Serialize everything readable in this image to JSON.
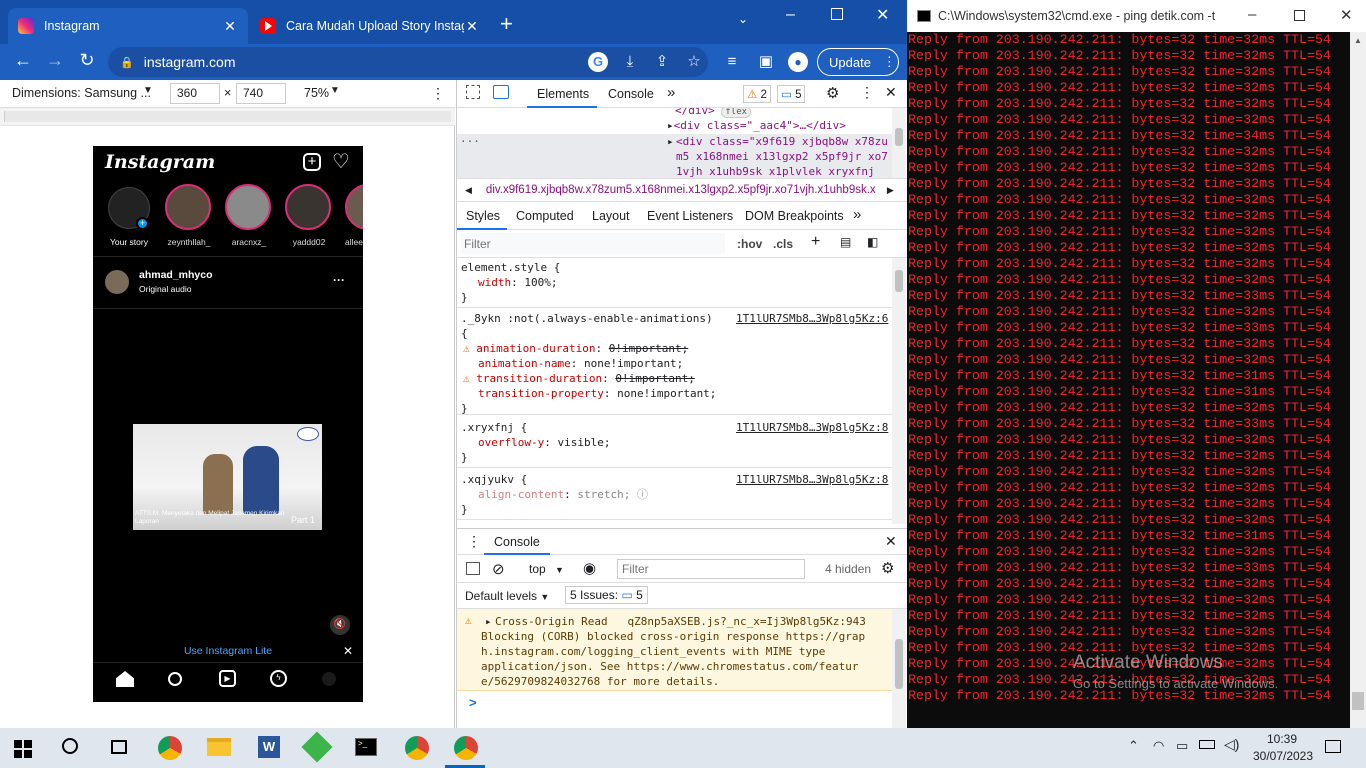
{
  "chrome": {
    "tabs": [
      {
        "title": "Instagram",
        "active": true
      },
      {
        "title": "Cara Mudah Upload Story Instagr",
        "active": false
      }
    ],
    "new_tab": "+",
    "url": "instagram.com",
    "update_label": "Update"
  },
  "device_toolbar": {
    "dimensions_label": "Dimensions: Samsung ...",
    "width": "360",
    "times": "×",
    "height": "740",
    "zoom": "75%"
  },
  "instagram": {
    "logo": "Instagram",
    "stories": [
      {
        "name": "Your story"
      },
      {
        "name": "zeynthllah_"
      },
      {
        "name": "aracnxz_"
      },
      {
        "name": "yaddd02"
      },
      {
        "name": "allee"
      }
    ],
    "post_user": "ahmad_mhyco",
    "post_subtitle": "Original audio",
    "video_caption": "ATTS.M. Menyetaka dan Melipat Jasamen Kirimkan Laporan",
    "video_part": "Part 1",
    "lite_banner": "Use Instagram Lite",
    "more": "···"
  },
  "devtools": {
    "tabs": [
      "Elements",
      "Console"
    ],
    "more_tabs": "»",
    "warn_count": "2",
    "msg_count": "5",
    "dom_lines": [
      {
        "text": "</div>",
        "badge": "flex"
      },
      {
        "text": "<div class=\"_aac4\">…</div>"
      },
      {
        "text": "<div class=\"x9f619 xjbqb8w x78zum5 x168nmei x13lgxp2 x5pf9jr xo71vjh x1uhb9sk x1plvlek xryxfnj"
      }
    ],
    "breadcrumb": "div.x9f619.xjbqb8w.x78zum5.x168nmei.x13lgxp2.x5pf9jr.xo71vjh.x1uhb9sk.x",
    "style_tabs": [
      "Styles",
      "Computed",
      "Layout",
      "Event Listeners",
      "DOM Breakpoints"
    ],
    "filter_placeholder": "Filter",
    "hov": ":hov",
    "cls": ".cls",
    "rules": [
      {
        "selector": "element.style {",
        "source": "",
        "decls": [
          {
            "prop": "width",
            "val": "100%;",
            "struck": false,
            "warn": false
          }
        ]
      },
      {
        "selector": "._8ykn :not(.always-enable-animations)",
        "source": "1T1lUR7SMb8…3Wp8lg5Kz:6",
        "decls": [
          {
            "prop": "animation-duration",
            "val": "0!important;",
            "struck": true,
            "warn": true
          },
          {
            "prop": "animation-name",
            "val": "none!important;",
            "struck": false,
            "warn": false
          },
          {
            "prop": "transition-duration",
            "val": "0!important;",
            "struck": true,
            "warn": true
          },
          {
            "prop": "transition-property",
            "val": "none!important;",
            "struck": false,
            "warn": false
          }
        ]
      },
      {
        "selector": ".xryxfnj {",
        "source": "1T1lUR7SMb8…3Wp8lg5Kz:8",
        "decls": [
          {
            "prop": "overflow-y",
            "val": "visible;",
            "struck": false,
            "warn": false
          }
        ]
      },
      {
        "selector": ".xqjyukv {",
        "source": "1T1lUR7SMb8…3Wp8lg5Kz:8",
        "decls": [
          {
            "prop": "align-content",
            "val": "stretch;",
            "struck": false,
            "warn": false
          }
        ]
      }
    ],
    "console": {
      "title": "Console",
      "context": "top",
      "filter_placeholder": "Filter",
      "hidden": "4 hidden",
      "levels": "Default levels",
      "issues_label": "5 Issues:",
      "issues_count": "5",
      "message_lines": [
        "Cross-Origin Read   qZ8np5aXSEB.js?_nc_x=Ij3Wp8lg5Kz:943",
        "Blocking (CORB) blocked cross-origin response https://grap",
        "h.instagram.com/logging_client_events with MIME type",
        "application/json. See https://www.chromestatus.com/featur",
        "e/5629709824032768 for more details."
      ],
      "prompt": ">"
    }
  },
  "cmd": {
    "title": "C:\\Windows\\system32\\cmd.exe - ping  detik.com -t",
    "lines": [
      "Reply from 203.190.242.211: bytes=32 time=32ms TTL=54",
      "Reply from 203.190.242.211: bytes=32 time=32ms TTL=54",
      "Reply from 203.190.242.211: bytes=32 time=32ms TTL=54",
      "Reply from 203.190.242.211: bytes=32 time=32ms TTL=54",
      "Reply from 203.190.242.211: bytes=32 time=32ms TTL=54",
      "Reply from 203.190.242.211: bytes=32 time=32ms TTL=54",
      "Reply from 203.190.242.211: bytes=32 time=34ms TTL=54",
      "Reply from 203.190.242.211: bytes=32 time=32ms TTL=54",
      "Reply from 203.190.242.211: bytes=32 time=32ms TTL=54",
      "Reply from 203.190.242.211: bytes=32 time=32ms TTL=54",
      "Reply from 203.190.242.211: bytes=32 time=32ms TTL=54",
      "Reply from 203.190.242.211: bytes=32 time=32ms TTL=54",
      "Reply from 203.190.242.211: bytes=32 time=32ms TTL=54",
      "Reply from 203.190.242.211: bytes=32 time=32ms TTL=54",
      "Reply from 203.190.242.211: bytes=32 time=32ms TTL=54",
      "Reply from 203.190.242.211: bytes=32 time=32ms TTL=54",
      "Reply from 203.190.242.211: bytes=32 time=33ms TTL=54",
      "Reply from 203.190.242.211: bytes=32 time=32ms TTL=54",
      "Reply from 203.190.242.211: bytes=32 time=33ms TTL=54",
      "Reply from 203.190.242.211: bytes=32 time=32ms TTL=54",
      "Reply from 203.190.242.211: bytes=32 time=32ms TTL=54",
      "Reply from 203.190.242.211: bytes=32 time=31ms TTL=54",
      "Reply from 203.190.242.211: bytes=32 time=31ms TTL=54",
      "Reply from 203.190.242.211: bytes=32 time=32ms TTL=54",
      "Reply from 203.190.242.211: bytes=32 time=33ms TTL=54",
      "Reply from 203.190.242.211: bytes=32 time=32ms TTL=54",
      "Reply from 203.190.242.211: bytes=32 time=32ms TTL=54",
      "Reply from 203.190.242.211: bytes=32 time=32ms TTL=54",
      "Reply from 203.190.242.211: bytes=32 time=32ms TTL=54",
      "Reply from 203.190.242.211: bytes=32 time=32ms TTL=54",
      "Reply from 203.190.242.211: bytes=32 time=32ms TTL=54",
      "Reply from 203.190.242.211: bytes=32 time=31ms TTL=54",
      "Reply from 203.190.242.211: bytes=32 time=32ms TTL=54",
      "Reply from 203.190.242.211: bytes=32 time=33ms TTL=54",
      "Reply from 203.190.242.211: bytes=32 time=32ms TTL=54",
      "Reply from 203.190.242.211: bytes=32 time=32ms TTL=54",
      "Reply from 203.190.242.211: bytes=32 time=32ms TTL=54",
      "Reply from 203.190.242.211: bytes=32 time=32ms TTL=54",
      "Reply from 203.190.242.211: bytes=32 time=32ms TTL=54",
      "Reply from 203.190.242.211: bytes=32 time=32ms TTL=54",
      "Reply from 203.190.242.211: bytes=32 time=32ms TTL=54",
      "Reply from 203.190.242.211: bytes=32 time=32ms TTL=54"
    ],
    "watermark_line1": "Activate Windows",
    "watermark_line2": "Go to Settings to activate Windows."
  },
  "taskbar": {
    "time": "10:39",
    "date": "30/07/2023"
  },
  "colors": {
    "chrome_blue": "#1f5fbf",
    "cmd_red": "#f2242c",
    "ig_bg": "#000000"
  }
}
